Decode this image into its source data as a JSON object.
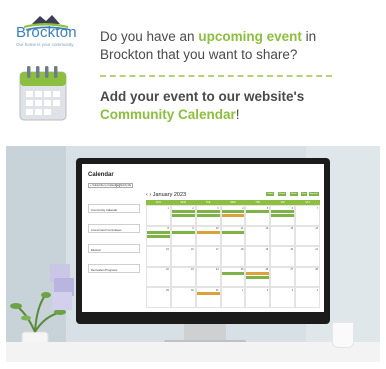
{
  "brand": {
    "logo_text": "Brockton",
    "tagline": "Our home is your community"
  },
  "headline": {
    "pre": "Do you have an ",
    "highlight": "upcoming event",
    "post": " in Brockton that you want to share?"
  },
  "cta": {
    "pre": "Add your event to our website's ",
    "highlight": "Community Calendar",
    "post": "!"
  },
  "screen": {
    "title": "Calendar",
    "buttons": [
      "+ Subscribe to iCalendar",
      "+ Notify Me"
    ],
    "month_label": "January 2023",
    "toolbar": [
      "Today",
      "Month",
      "Week",
      "Day",
      "Agenda"
    ],
    "filters": [
      "Community Calendar",
      "Council and Committees",
      "Election",
      "Recreation Programs"
    ],
    "weekdays": [
      "SUN",
      "MON",
      "TUE",
      "WED",
      "THU",
      "FRI",
      "SAT"
    ],
    "day_numbers": [
      "1",
      "2",
      "3",
      "4",
      "5",
      "6",
      "7",
      "8",
      "9",
      "10",
      "11",
      "12",
      "13",
      "14",
      "15",
      "16",
      "17",
      "18",
      "19",
      "20",
      "21",
      "22",
      "23",
      "24",
      "25",
      "26",
      "27",
      "28",
      "29",
      "30",
      "31",
      "1",
      "2",
      "3",
      "4"
    ]
  },
  "colors": {
    "accent_green": "#8cbf3f",
    "logo_blue": "#3d7fb6",
    "body_text": "#4a4a4a",
    "event_green": "#7fb34a",
    "event_orange": "#d9a23a"
  }
}
